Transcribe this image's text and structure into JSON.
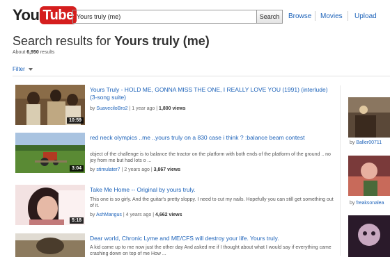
{
  "header": {
    "logo_you": "You",
    "logo_tube": "Tube",
    "search_value": "Yours truly (me)",
    "search_button": "Search",
    "nav": [
      "Browse",
      "Movies",
      "Upload"
    ]
  },
  "results_heading": {
    "prefix": "Search results for ",
    "query": "Yours truly (me)",
    "count_prefix": "About ",
    "count": "6,950",
    "count_suffix": " results"
  },
  "filter_label": "Filter",
  "results": [
    {
      "title": "Yours Truly - HOLD ME, GONNA MISS THE ONE, I REALLY LOVE YOU (1991) (interlude) (3-song suite)",
      "description": "",
      "channel": "SuaveciloBro2",
      "age": "1 year ago",
      "views": "1,800 views",
      "duration": "10:59",
      "thumb_colors": [
        "#7a5a3a",
        "#c9b48a",
        "#3b2a1e"
      ]
    },
    {
      "title": "red neck olympics ..me ..yours truly on a 830 case i think ? :balance beam contest",
      "description": "object of the challenge is to balance the tractor on the platform with both ends of the platform of the ground .. no joy from me but had lots o ...",
      "channel": "stimulater7",
      "age": "2 years ago",
      "views": "3,867 views",
      "duration": "3:04",
      "thumb_colors": [
        "#8fb0d6",
        "#4e7a2e",
        "#a33a22"
      ]
    },
    {
      "title": "Take Me Home -- Original by yours truly.",
      "description": "This one is so girly. And the guitar's pretty sloppy. I need to cut my nails. Hopefully you can still get something out of it.",
      "channel": "AshMangus",
      "age": "4 years ago",
      "views": "4,662 views",
      "duration": "5:18",
      "thumb_colors": [
        "#f1d6d6",
        "#b06a6a",
        "#2b1a1a"
      ]
    },
    {
      "title": "Dear world, Chronic Lyme and ME/CFS will destroy your life. Yours truly.",
      "description": "A kid came up to me now just the other day And asked me if I thought about what I would say if everything came crashing down on top of me How ...",
      "channel": "",
      "age": "",
      "views": "",
      "duration": "",
      "thumb_colors": [
        "#d8d2c8",
        "#7c6a50",
        "#3a3026"
      ]
    }
  ],
  "sidebar": [
    {
      "by_prefix": "by ",
      "channel": "Baller00711"
    },
    {
      "by_prefix": "by ",
      "channel": "freaksonalea"
    },
    {
      "by_prefix": "",
      "channel": ""
    }
  ],
  "meta_labels": {
    "by": "by "
  },
  "colors": {
    "link": "#1c62b9",
    "brand_red": "#d51e1e"
  }
}
